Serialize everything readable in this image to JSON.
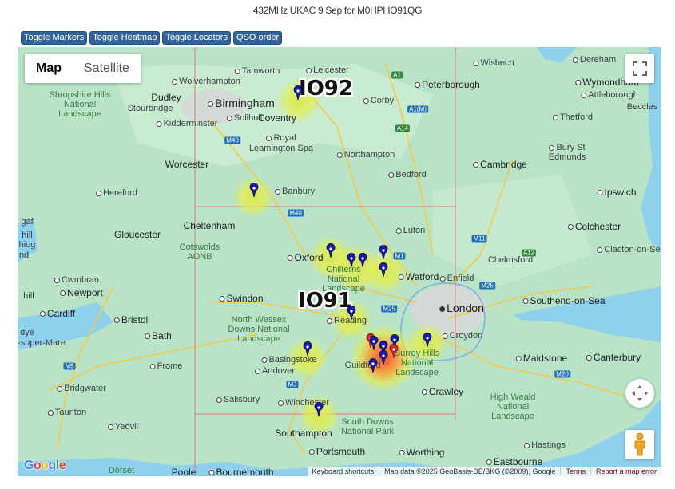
{
  "page": {
    "title": "432MHz UKAC 9 Sep for M0HPI IO91QG"
  },
  "toolbar": {
    "toggle_markers": "Toggle Markers",
    "toggle_heatmap": "Toggle Heatmap",
    "toggle_locators": "Toggle Locators",
    "qso_order": "QSO order"
  },
  "map_controls": {
    "map_label": "Map",
    "satellite_label": "Satellite",
    "selected_type": "Map"
  },
  "locators": {
    "top": "IO92",
    "bottom": "IO91"
  },
  "places": {
    "leicester": "Leicester",
    "tamworth": "Tamworth",
    "wolverhampton": "Wolverhampton",
    "wisbech": "Wisbech",
    "dereham": "Dereham",
    "wymondham": "Wymondham",
    "attleborough": "Attleborough",
    "beccles": "Beccles",
    "peterborough": "Peterborough",
    "shropshire": "Shropshire Hills National Landscape",
    "dudley": "Dudley",
    "birmingham": "Birmingham",
    "corby": "Corby",
    "stourbridge": "Stourbridge",
    "solihull": "Solihull",
    "coventry": "Coventry",
    "kidderminster": "Kidderminster",
    "thetford": "Thetford",
    "royal_leamington": "Royal Leamington Spa",
    "bury": "Bury St Edmunds",
    "northampton": "Northampton",
    "worcester": "Worcester",
    "bedford": "Bedford",
    "cambridge": "Cambridge",
    "hereford": "Hereford",
    "banbury": "Banbury",
    "ipswich": "Ipswich",
    "cheltenham": "Cheltenham",
    "gloucester": "Gloucester",
    "luton": "Luton",
    "colchester": "Colchester",
    "cotswolds": "Cotswolds AONB",
    "chelmsford": "Chelmsford",
    "oxford": "Oxford",
    "clacton": "Clacton-on-Sea",
    "chilterns": "Chilterns National Landscape",
    "watford": "Watford",
    "enfield": "Enfield",
    "cwmbran": "Cwmbran",
    "newport": "Newport",
    "swindon": "Swindon",
    "london": "London",
    "southend": "Southend-on-Sea",
    "cardiff": "Cardiff",
    "bristol": "Bristol",
    "north_wessex": "North Wessex Downs National Landscape",
    "reading": "Reading",
    "bath": "Bath",
    "croydon": "Croydon",
    "weston": "-super-Mare",
    "basingstoke": "Basingstoke",
    "guildford": "Guildford",
    "surrey_hills": "Surrey Hills National Landscape",
    "maidstone": "Maidstone",
    "canterbury": "Canterbury",
    "frome": "Frome",
    "andover": "Andover",
    "bridgwater": "Bridgwater",
    "crawley": "Crawley",
    "salisbury": "Salisbury",
    "winchester": "Winchester",
    "high_weald": "High Weald National Landscape",
    "taunton": "Taunton",
    "south_downs": "South Downs National Park",
    "southampton": "Southampton",
    "yeovil": "Yeovil",
    "portsmouth": "Portsmouth",
    "hastings": "Hastings",
    "worthing": "Worthing",
    "eastbourne": "Eastbourne",
    "dorset": "Dorset",
    "poole": "Poole",
    "bournemouth": "Bournemouth",
    "gaf": "gaf",
    "hill": "hill",
    "hiog": "hiog",
    "nd": "nd",
    "dye": "dye"
  },
  "roads": {
    "m40a": "M40",
    "m40b": "M40",
    "a1": "A1",
    "a1m": "A1(M)",
    "a14": "A14",
    "m11": "M11",
    "a12": "A12",
    "m1": "M1",
    "m25a": "M25",
    "m25b": "M25",
    "m5": "M5",
    "m3": "M3",
    "m20": "M20"
  },
  "attribution": {
    "shortcuts": "Keyboard shortcuts",
    "map_data": "Map data ©2025 GeoBasis-DE/BKG (©2009), Google",
    "terms": "Terms",
    "report": "Report a map error"
  },
  "logo": "Google",
  "colors": {
    "button_bg": "#346497",
    "marker": "#1a1aa8",
    "marker_red": "#cc2a2a",
    "water": "#8fd0ec",
    "land": "#b9e3c6",
    "grid": "#e0787a"
  }
}
